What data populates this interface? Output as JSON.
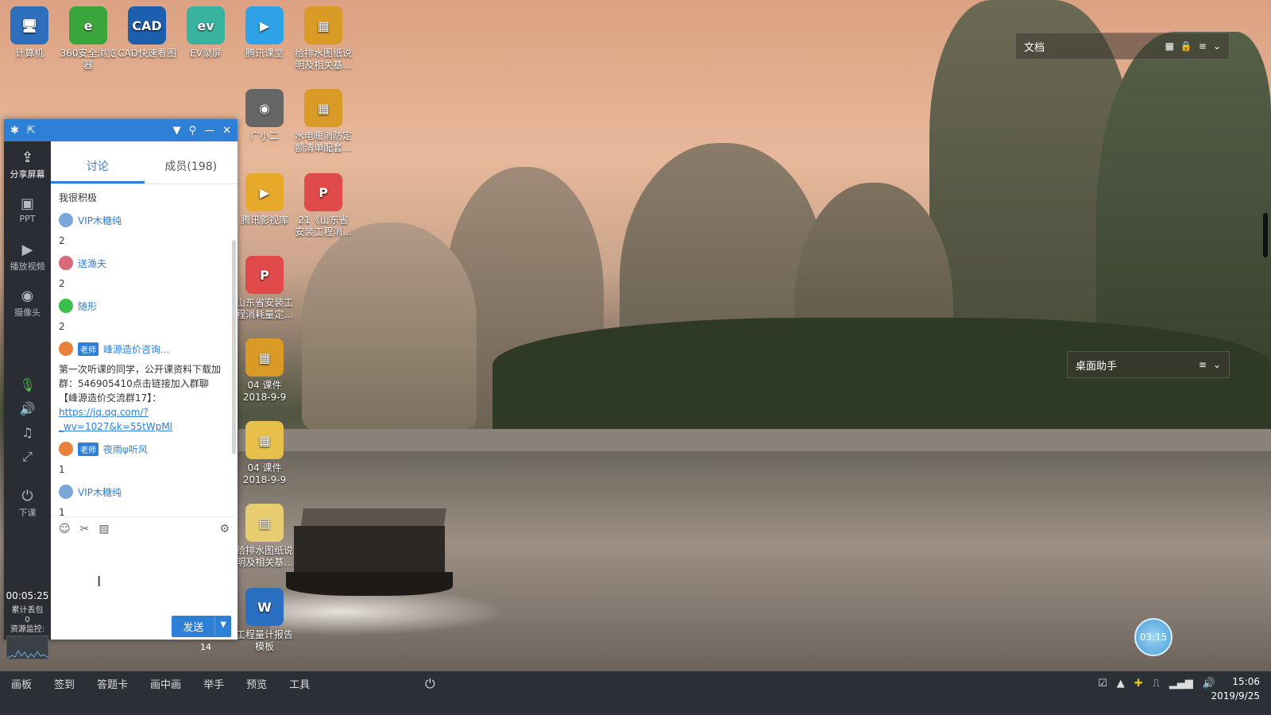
{
  "desktop": {
    "icons": [
      {
        "label": "计算机",
        "glyph": "🖥",
        "color": "#2d6fbd"
      },
      {
        "label": "360安全浏览器",
        "glyph": "e",
        "color": "#3aa53a"
      },
      {
        "label": "CAD快速看图",
        "glyph": "CAD",
        "color": "#1b5fae"
      },
      {
        "label": "EV录屏",
        "glyph": "ev",
        "color": "#38b3a0"
      },
      {
        "label": "腾讯课堂",
        "glyph": "▶",
        "color": "#2da2e6"
      },
      {
        "label": "给排水图纸说明及相关基...",
        "glyph": "▦",
        "color": "#d99a26"
      },
      {
        "label": "广小二",
        "glyph": "◉",
        "color": "#666666"
      },
      {
        "label": "水电暖消防定额清单配套...",
        "glyph": "▦",
        "color": "#d99a26"
      },
      {
        "label": "腾讯影视库",
        "glyph": "▶",
        "color": "#e6a92a"
      },
      {
        "label": "21《山东省安装工程消...",
        "glyph": "P",
        "color": "#e04a4a"
      },
      {
        "label": "山东省安装工程消耗量定...",
        "glyph": "P",
        "color": "#e04a4a"
      },
      {
        "label": "04 课件 2018-9-9",
        "glyph": "▦",
        "color": "#d99a26"
      },
      {
        "label": "04 课件 2018-9-9",
        "glyph": "▦",
        "color": "#e6c04a"
      },
      {
        "label": "给排水图纸说明及相关基...",
        "glyph": "▤",
        "color": "#e8cc70"
      },
      {
        "label": "工程量计报告模板",
        "glyph": "W",
        "color": "#2b6fc2"
      }
    ]
  },
  "widgets": {
    "docs": {
      "label": "文档"
    },
    "assistant": {
      "label": "桌面助手"
    }
  },
  "chat": {
    "sidebar": {
      "items": [
        {
          "label": "分享屏幕",
          "glyph": "⇪"
        },
        {
          "label": "PPT",
          "glyph": "▣"
        },
        {
          "label": "播放视频",
          "glyph": "▶"
        },
        {
          "label": "摄像头",
          "glyph": "◉"
        }
      ],
      "end_label": "下课",
      "timer": "00:05:25",
      "stats_line1": "累计丢包",
      "stats_line2": "0",
      "stats_line3": "资源监控:"
    },
    "tabs": {
      "discussion": "讨论",
      "members": "成员(198)"
    },
    "messages": {
      "m0_text": "我很积极",
      "m1_user": "VIP木糖纯",
      "m1_text": "2",
      "m2_user": "送渔夫",
      "m2_text": "2",
      "m3_user": "随形",
      "m3_text": "2",
      "m4_badge": "老师",
      "m4_user": "峰源造价咨询...",
      "m4_text": "第一次听课的同学，公开课资料下载加群：546905410点击链接加入群聊【峰源造价交流群17】：",
      "m4_link": "https://jq.qq.com/?_wv=1027&k=55tWpMl",
      "m5_badge": "老师",
      "m5_user": "夜雨ψ听风",
      "m5_text": "1",
      "m6_user": "VIP木糖纯",
      "m6_text": "1"
    },
    "send_label": "发送",
    "page_number": "14"
  },
  "taskbar": {
    "items": [
      "画板",
      "签到",
      "答题卡",
      "画中画",
      "举手",
      "预览",
      "工具"
    ],
    "time": "15:06",
    "date": "2019/9/25"
  },
  "countdown": "03:15"
}
